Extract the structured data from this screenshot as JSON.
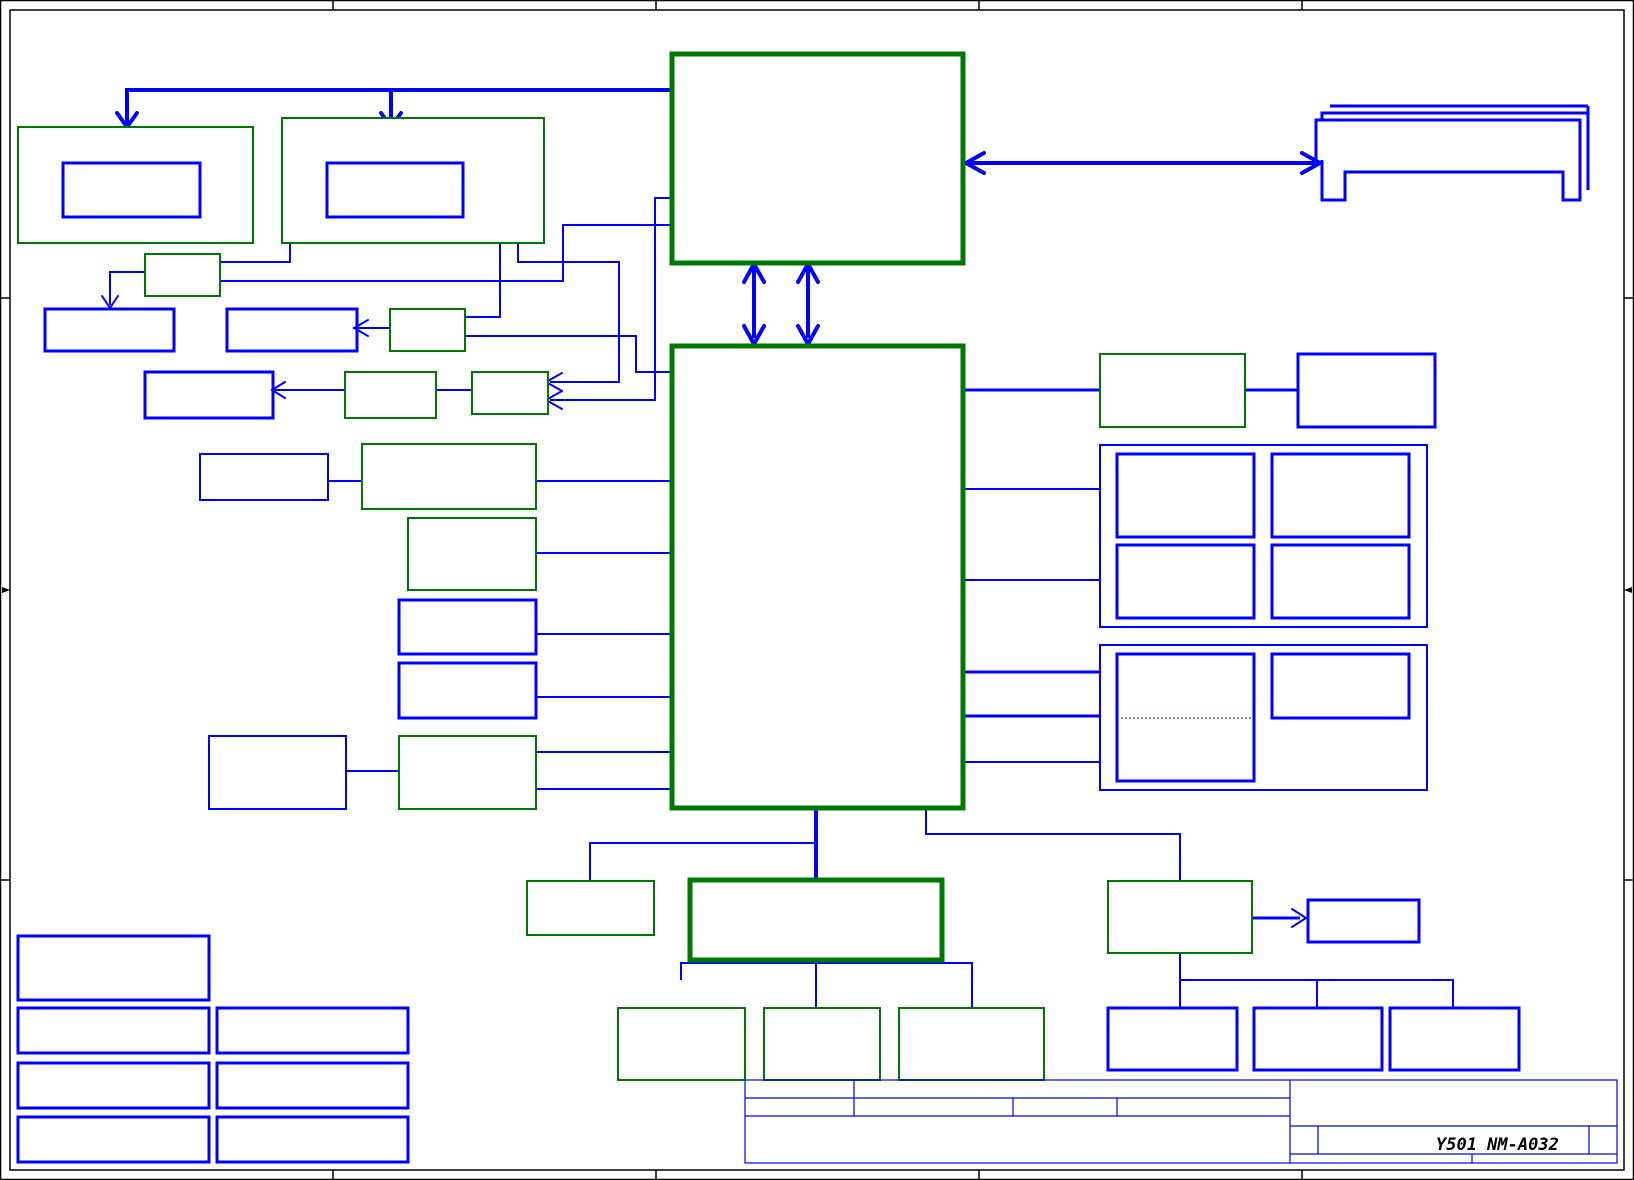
{
  "title_block": {
    "project_name": "Y501  NM-A032"
  },
  "colors": {
    "frame": "#000000",
    "signal": "#0000ff",
    "chip_block": "#007700",
    "background": "#ffffff"
  }
}
